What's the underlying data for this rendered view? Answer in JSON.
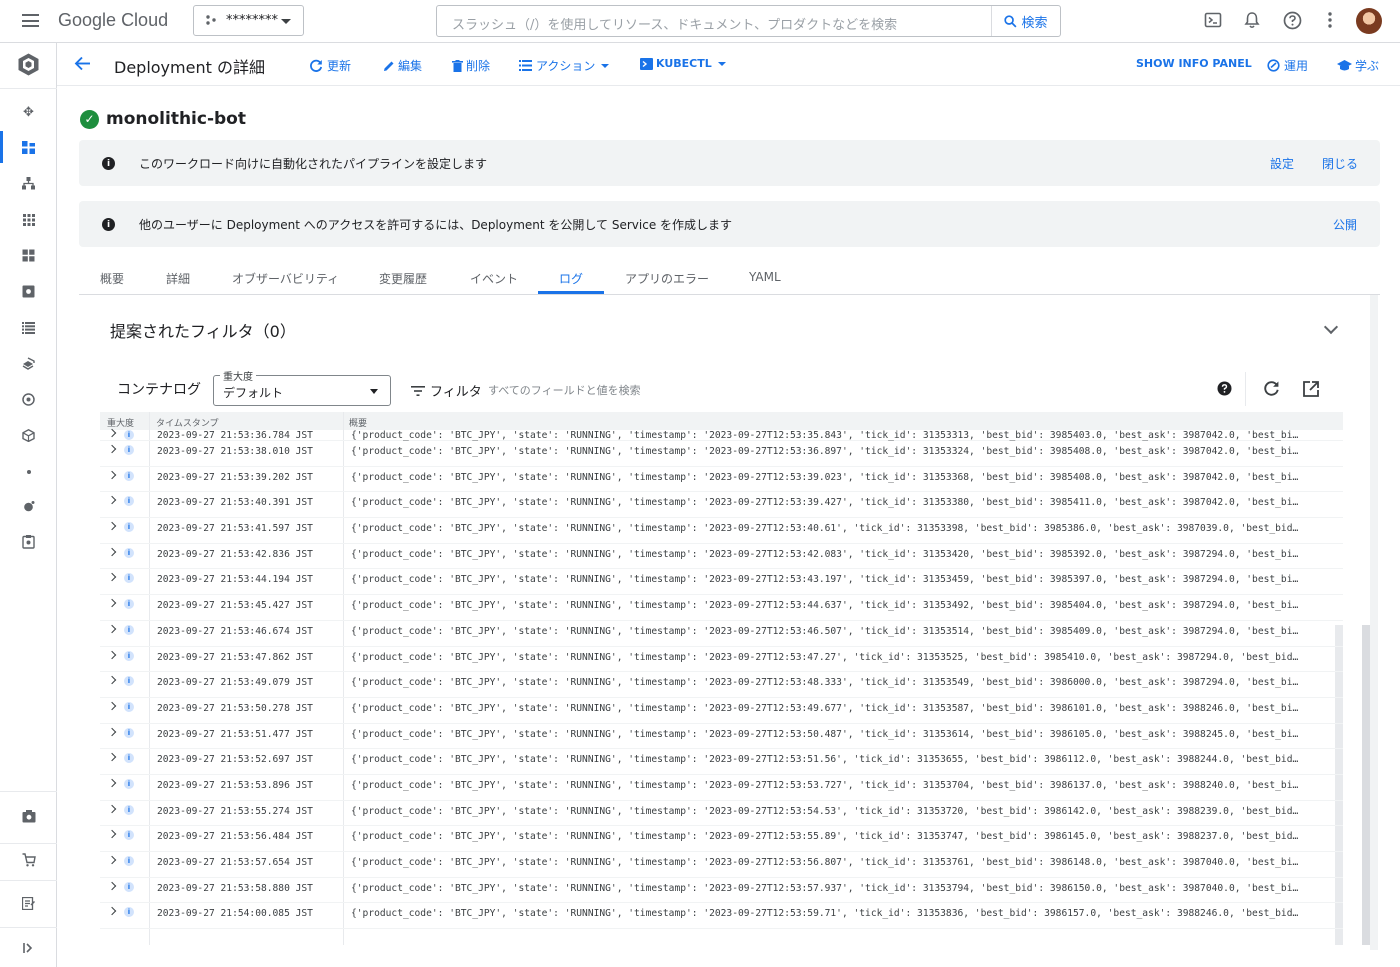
{
  "topbar": {
    "logo_google": "Google",
    "logo_cloud": "Cloud",
    "project_name": "********",
    "search_placeholder": "スラッシュ（/）を使用してリソース、ドキュメント、プロダクトなどを検索",
    "search_button": "検索",
    "icons": [
      "cloud-shell-icon",
      "notifications-icon",
      "help-icon",
      "more-vert-icon"
    ]
  },
  "header": {
    "title": "Deployment の詳細",
    "refresh": "更新",
    "edit": "編集",
    "delete": "削除",
    "actions": "アクション",
    "kubectl": "KUBECTL",
    "show_info_panel": "SHOW INFO PANEL",
    "operate": "運用",
    "learn": "学ぶ"
  },
  "resource": {
    "name": "monolithic-bot",
    "status": "ok"
  },
  "banners": [
    {
      "message": "このワークロード向けに自動化されたパイプラインを設定します",
      "links": [
        "設定",
        "閉じる"
      ]
    },
    {
      "message": "他のユーザーに Deployment へのアクセスを許可するには、Deployment を公開して Service を作成します",
      "links": [
        "公開"
      ]
    }
  ],
  "tabs": [
    {
      "label": "概要",
      "active": false
    },
    {
      "label": "詳細",
      "active": false
    },
    {
      "label": "オブザーバビリティ",
      "active": false
    },
    {
      "label": "変更履歴",
      "active": false
    },
    {
      "label": "イベント",
      "active": false
    },
    {
      "label": "ログ",
      "active": true
    },
    {
      "label": "アプリのエラー",
      "active": false
    },
    {
      "label": "YAML",
      "active": false
    }
  ],
  "logs": {
    "suggested_filters": "提案されたフィルタ（0）",
    "container_log_label": "コンテナログ",
    "severity_label": "重大度",
    "severity_value": "デフォルト",
    "filter_label": "フィルタ",
    "filter_placeholder": "すべてのフィールドと値を検索",
    "columns": {
      "severity": "重大度",
      "timestamp": "タイムスタンプ",
      "summary": "概要"
    },
    "rows": [
      {
        "timestamp": "2023-09-27 21:53:36.784 JST",
        "summary": "{'product_code': 'BTC_JPY', 'state': 'RUNNING', 'timestamp': '2023-09-27T12:53:35.843', 'tick_id': 31353313, 'best_bid': 3985403.0, 'best_ask': 3987042.0, 'best_bi…"
      },
      {
        "timestamp": "2023-09-27 21:53:38.010 JST",
        "summary": "{'product_code': 'BTC_JPY', 'state': 'RUNNING', 'timestamp': '2023-09-27T12:53:36.897', 'tick_id': 31353324, 'best_bid': 3985408.0, 'best_ask': 3987042.0, 'best_bi…"
      },
      {
        "timestamp": "2023-09-27 21:53:39.202 JST",
        "summary": "{'product_code': 'BTC_JPY', 'state': 'RUNNING', 'timestamp': '2023-09-27T12:53:39.023', 'tick_id': 31353368, 'best_bid': 3985408.0, 'best_ask': 3987042.0, 'best_bi…"
      },
      {
        "timestamp": "2023-09-27 21:53:40.391 JST",
        "summary": "{'product_code': 'BTC_JPY', 'state': 'RUNNING', 'timestamp': '2023-09-27T12:53:39.427', 'tick_id': 31353380, 'best_bid': 3985411.0, 'best_ask': 3987042.0, 'best_bi…"
      },
      {
        "timestamp": "2023-09-27 21:53:41.597 JST",
        "summary": "{'product_code': 'BTC_JPY', 'state': 'RUNNING', 'timestamp': '2023-09-27T12:53:40.61', 'tick_id': 31353398, 'best_bid': 3985386.0, 'best_ask': 3987039.0, 'best_bid…"
      },
      {
        "timestamp": "2023-09-27 21:53:42.836 JST",
        "summary": "{'product_code': 'BTC_JPY', 'state': 'RUNNING', 'timestamp': '2023-09-27T12:53:42.083', 'tick_id': 31353420, 'best_bid': 3985392.0, 'best_ask': 3987294.0, 'best_bi…"
      },
      {
        "timestamp": "2023-09-27 21:53:44.194 JST",
        "summary": "{'product_code': 'BTC_JPY', 'state': 'RUNNING', 'timestamp': '2023-09-27T12:53:43.197', 'tick_id': 31353459, 'best_bid': 3985397.0, 'best_ask': 3987294.0, 'best_bi…"
      },
      {
        "timestamp": "2023-09-27 21:53:45.427 JST",
        "summary": "{'product_code': 'BTC_JPY', 'state': 'RUNNING', 'timestamp': '2023-09-27T12:53:44.637', 'tick_id': 31353492, 'best_bid': 3985404.0, 'best_ask': 3987294.0, 'best_bi…"
      },
      {
        "timestamp": "2023-09-27 21:53:46.674 JST",
        "summary": "{'product_code': 'BTC_JPY', 'state': 'RUNNING', 'timestamp': '2023-09-27T12:53:46.507', 'tick_id': 31353514, 'best_bid': 3985409.0, 'best_ask': 3987294.0, 'best_bi…"
      },
      {
        "timestamp": "2023-09-27 21:53:47.862 JST",
        "summary": "{'product_code': 'BTC_JPY', 'state': 'RUNNING', 'timestamp': '2023-09-27T12:53:47.27', 'tick_id': 31353525, 'best_bid': 3985410.0, 'best_ask': 3987294.0, 'best_bid…"
      },
      {
        "timestamp": "2023-09-27 21:53:49.079 JST",
        "summary": "{'product_code': 'BTC_JPY', 'state': 'RUNNING', 'timestamp': '2023-09-27T12:53:48.333', 'tick_id': 31353549, 'best_bid': 3986000.0, 'best_ask': 3987294.0, 'best_bi…"
      },
      {
        "timestamp": "2023-09-27 21:53:50.278 JST",
        "summary": "{'product_code': 'BTC_JPY', 'state': 'RUNNING', 'timestamp': '2023-09-27T12:53:49.677', 'tick_id': 31353587, 'best_bid': 3986101.0, 'best_ask': 3988246.0, 'best_bi…"
      },
      {
        "timestamp": "2023-09-27 21:53:51.477 JST",
        "summary": "{'product_code': 'BTC_JPY', 'state': 'RUNNING', 'timestamp': '2023-09-27T12:53:50.487', 'tick_id': 31353614, 'best_bid': 3986105.0, 'best_ask': 3988245.0, 'best_bi…"
      },
      {
        "timestamp": "2023-09-27 21:53:52.697 JST",
        "summary": "{'product_code': 'BTC_JPY', 'state': 'RUNNING', 'timestamp': '2023-09-27T12:53:51.56', 'tick_id': 31353655, 'best_bid': 3986112.0, 'best_ask': 3988244.0, 'best_bid…"
      },
      {
        "timestamp": "2023-09-27 21:53:53.896 JST",
        "summary": "{'product_code': 'BTC_JPY', 'state': 'RUNNING', 'timestamp': '2023-09-27T12:53:53.727', 'tick_id': 31353704, 'best_bid': 3986137.0, 'best_ask': 3988240.0, 'best_bi…"
      },
      {
        "timestamp": "2023-09-27 21:53:55.274 JST",
        "summary": "{'product_code': 'BTC_JPY', 'state': 'RUNNING', 'timestamp': '2023-09-27T12:53:54.53', 'tick_id': 31353720, 'best_bid': 3986142.0, 'best_ask': 3988239.0, 'best_bid…"
      },
      {
        "timestamp": "2023-09-27 21:53:56.484 JST",
        "summary": "{'product_code': 'BTC_JPY', 'state': 'RUNNING', 'timestamp': '2023-09-27T12:53:55.89', 'tick_id': 31353747, 'best_bid': 3986145.0, 'best_ask': 3988237.0, 'best_bid…"
      },
      {
        "timestamp": "2023-09-27 21:53:57.654 JST",
        "summary": "{'product_code': 'BTC_JPY', 'state': 'RUNNING', 'timestamp': '2023-09-27T12:53:56.807', 'tick_id': 31353761, 'best_bid': 3986148.0, 'best_ask': 3987040.0, 'best_bi…"
      },
      {
        "timestamp": "2023-09-27 21:53:58.880 JST",
        "summary": "{'product_code': 'BTC_JPY', 'state': 'RUNNING', 'timestamp': '2023-09-27T12:53:57.937', 'tick_id': 31353794, 'best_bid': 3986150.0, 'best_ask': 3987040.0, 'best_bi…"
      },
      {
        "timestamp": "2023-09-27 21:54:00.085 JST",
        "summary": "{'product_code': 'BTC_JPY', 'state': 'RUNNING', 'timestamp': '2023-09-27T12:53:59.71', 'tick_id': 31353836, 'best_bid': 3986157.0, 'best_ask': 3988246.0, 'best_bid…"
      }
    ]
  },
  "colors": {
    "accent": "#1a73e8",
    "success": "#1e8e3e",
    "banner_bg": "#f1f3f4"
  }
}
